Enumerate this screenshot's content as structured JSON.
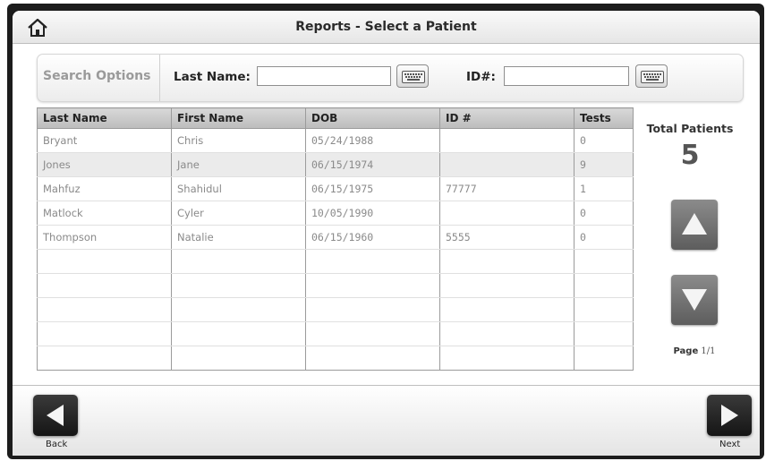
{
  "header": {
    "title": "Reports - Select a Patient",
    "home_icon": "home-icon"
  },
  "search": {
    "section_label": "Search Options",
    "last_name_label": "Last Name:",
    "last_name_value": "",
    "id_label": "ID#:",
    "id_value": "",
    "keyboard_icon": "keyboard-icon"
  },
  "table": {
    "columns": [
      "Last Name",
      "First Name",
      "DOB",
      "ID #",
      "Tests"
    ],
    "rows": [
      [
        "Bryant",
        "Chris",
        "05/24/1988",
        "",
        "0"
      ],
      [
        "Jones",
        "Jane",
        "06/15/1974",
        "",
        "9"
      ],
      [
        "Mahfuz",
        "Shahidul",
        "06/15/1975",
        "77777",
        "1"
      ],
      [
        "Matlock",
        "Cyler",
        "10/05/1990",
        "",
        "0"
      ],
      [
        "Thompson",
        "Natalie",
        "06/15/1960",
        "5555",
        "0"
      ],
      [
        "",
        "",
        "",
        "",
        ""
      ],
      [
        "",
        "",
        "",
        "",
        ""
      ],
      [
        "",
        "",
        "",
        "",
        ""
      ],
      [
        "",
        "",
        "",
        "",
        ""
      ],
      [
        "",
        "",
        "",
        "",
        ""
      ]
    ]
  },
  "sidebar": {
    "total_label": "Total Patients",
    "total_count": "5",
    "page_label": "Page",
    "page_value": "1/1"
  },
  "footer": {
    "back_label": "Back",
    "next_label": "Next"
  },
  "colors": {
    "frame": "#1c1c1c",
    "header_bg": "#c8c8c8",
    "arrow_button": "#6e6e6e",
    "nav_button": "#222222"
  }
}
